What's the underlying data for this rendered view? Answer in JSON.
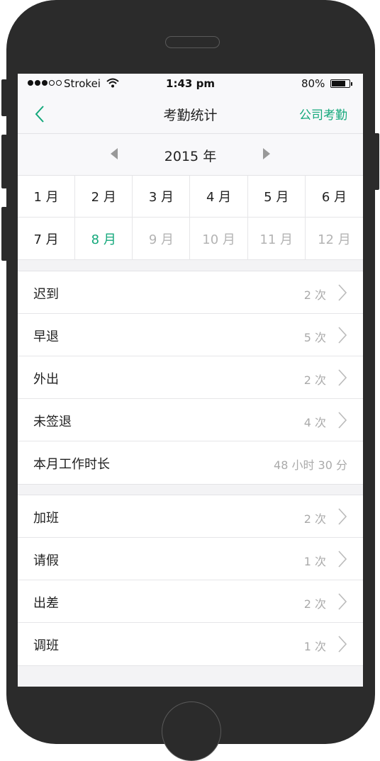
{
  "status_bar": {
    "carrier": "Strokei",
    "time": "1:43 pm",
    "battery": "80%",
    "battery_level": 0.8
  },
  "nav": {
    "back_icon": "chevron-left-icon",
    "title": "考勤统计",
    "right_action": "公司考勤"
  },
  "year_selector": {
    "year": "2015 年",
    "prev_icon": "triangle-left-icon",
    "next_icon": "triangle-right-icon"
  },
  "months": [
    {
      "label": "1 月",
      "state": "normal"
    },
    {
      "label": "2 月",
      "state": "normal"
    },
    {
      "label": "3 月",
      "state": "normal"
    },
    {
      "label": "4 月",
      "state": "normal"
    },
    {
      "label": "5 月",
      "state": "normal"
    },
    {
      "label": "6 月",
      "state": "normal"
    },
    {
      "label": "7 月",
      "state": "normal"
    },
    {
      "label": "8 月",
      "state": "active"
    },
    {
      "label": "9 月",
      "state": "disabled"
    },
    {
      "label": "10 月",
      "state": "disabled"
    },
    {
      "label": "11 月",
      "state": "disabled"
    },
    {
      "label": "12 月",
      "state": "disabled"
    }
  ],
  "attendance": [
    {
      "label": "迟到",
      "value": "2 次"
    },
    {
      "label": "早退",
      "value": "5 次"
    },
    {
      "label": "外出",
      "value": "2 次"
    },
    {
      "label": "未签退",
      "value": "4 次"
    },
    {
      "label": "本月工作时长",
      "value": "48 小时 30 分"
    }
  ],
  "requests": [
    {
      "label": "加班",
      "value": "2 次"
    },
    {
      "label": "请假",
      "value": "1 次"
    },
    {
      "label": "出差",
      "value": "2 次"
    },
    {
      "label": "调班",
      "value": "1 次"
    }
  ],
  "colors": {
    "accent": "#13a87b",
    "disabled": "#b3b3b3",
    "frame": "#2b2b2b"
  }
}
